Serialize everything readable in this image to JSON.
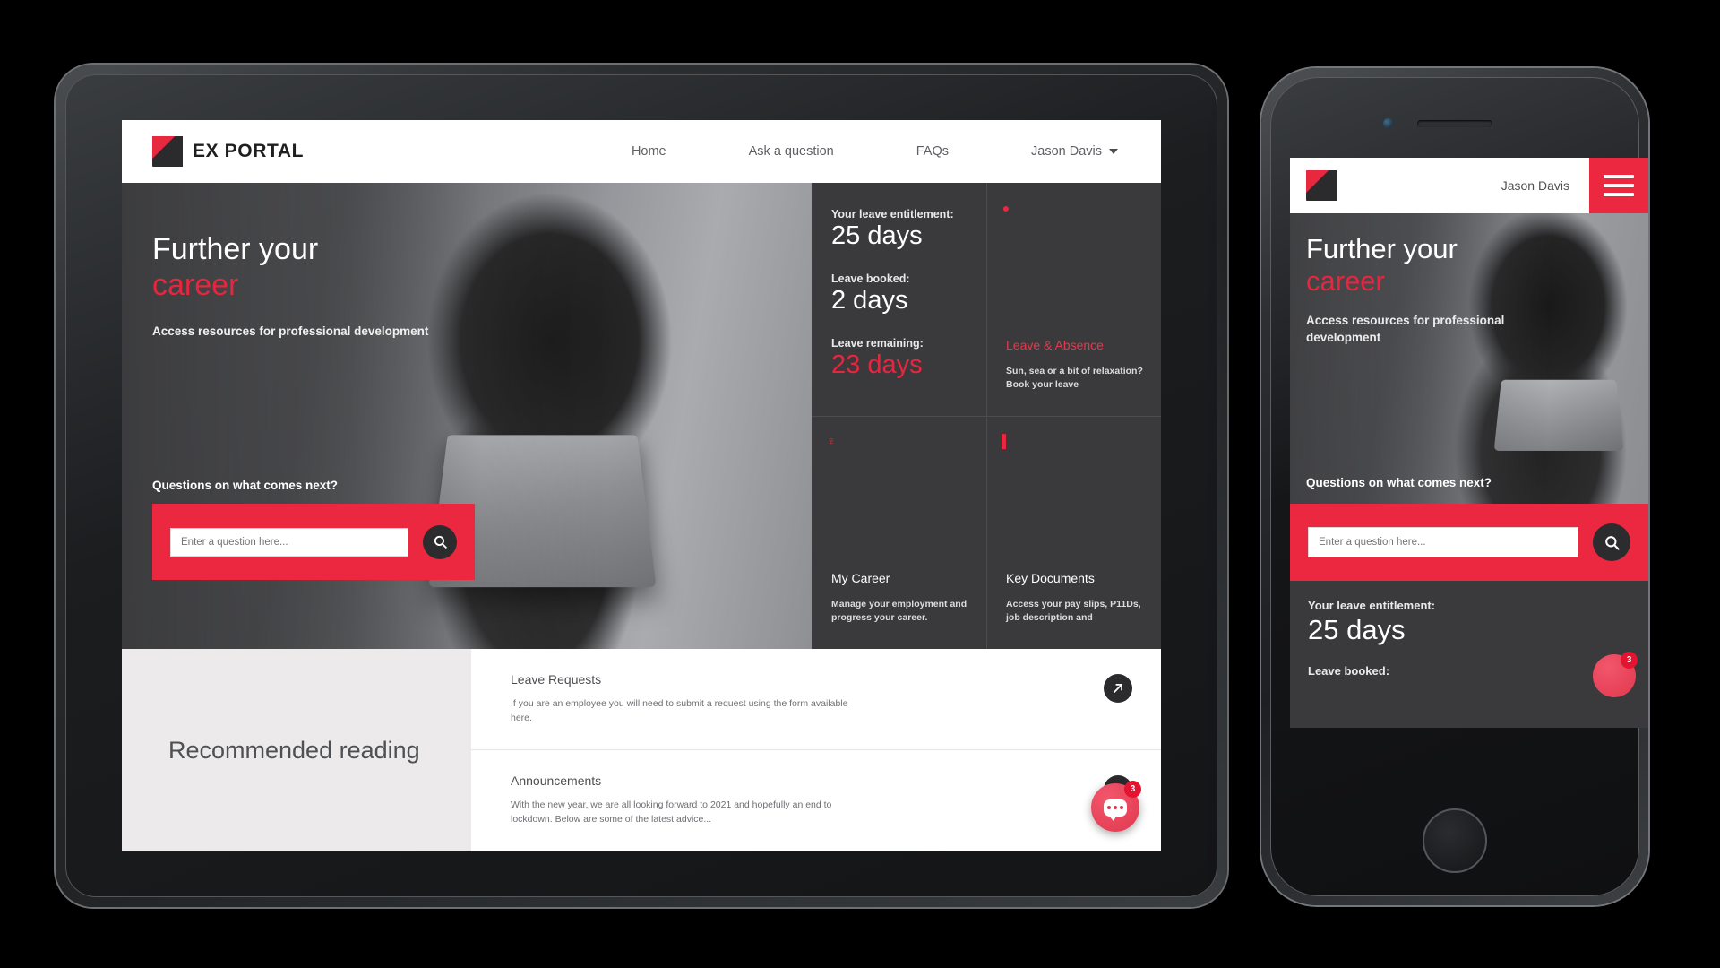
{
  "brand": {
    "name": "EX PORTAL",
    "accent_red": "#ec2840",
    "dark": "#3a3a3c",
    "logo_icon": "ex-portal-logo-icon"
  },
  "nav": {
    "items": [
      {
        "label": "Home"
      },
      {
        "label": "Ask a question"
      },
      {
        "label": "FAQs"
      }
    ],
    "user": {
      "label": "Jason Davis",
      "caret_icon": "chevron-down-icon"
    }
  },
  "hero": {
    "title_line1": "Further your",
    "title_line2": "career",
    "subtitle": "Access resources for professional development",
    "question_prompt": "Questions on what comes next?",
    "search": {
      "placeholder": "Enter a question here...",
      "value": "",
      "button_icon": "search-icon"
    }
  },
  "tiles": [
    {
      "kind": "stats",
      "stats": [
        {
          "label": "Your leave entitlement:",
          "value": "25 days",
          "accent": false
        },
        {
          "label": "Leave booked:",
          "value": "2 days",
          "accent": false
        },
        {
          "label": "Leave remaining:",
          "value": "23 days",
          "accent": true
        }
      ]
    },
    {
      "kind": "link",
      "icon": "leave-absence-icon",
      "glyph": "●",
      "title": "Leave & Absence",
      "title_accent": true,
      "description": "Sun, sea or a bit of relaxation? Book your leave"
    },
    {
      "kind": "link",
      "icon": "my-career-icon",
      "glyph": "♀",
      "title": "My Career",
      "title_accent": false,
      "description": "Manage your employment and progress your career."
    },
    {
      "kind": "link",
      "icon": "key-documents-icon",
      "glyph": "▌",
      "title": "Key Documents",
      "title_accent": false,
      "description": "Access your pay slips, P11Ds, job description and"
    }
  ],
  "recommended": {
    "heading": "Recommended reading",
    "items": [
      {
        "title": "Leave Requests",
        "description": "If you are an employee you will need to submit a request using the form available here.",
        "arrow_icon": "external-link-arrow-icon"
      },
      {
        "title": "Announcements",
        "description": "With the new year, we are all looking forward to 2021 and hopefully an end to lockdown. Below are some of the latest advice...",
        "arrow_icon": "external-link-arrow-icon"
      }
    ]
  },
  "chat": {
    "icon": "chat-bubble-icon",
    "badge": "3"
  },
  "mobile": {
    "user": "Jason Davis",
    "menu_icon": "hamburger-menu-icon",
    "title_line1": "Further your",
    "title_line2": "career",
    "subtitle": "Access resources for professional development",
    "question_prompt": "Questions on what comes next?",
    "search": {
      "placeholder": "Enter a question here...",
      "button_icon": "search-icon"
    },
    "stats": [
      {
        "label": "Your leave entitlement:",
        "value": "25 days"
      },
      {
        "label": "Leave booked:",
        "value": ""
      }
    ],
    "chat": {
      "icon": "chat-bubble-icon",
      "badge": "3"
    }
  }
}
